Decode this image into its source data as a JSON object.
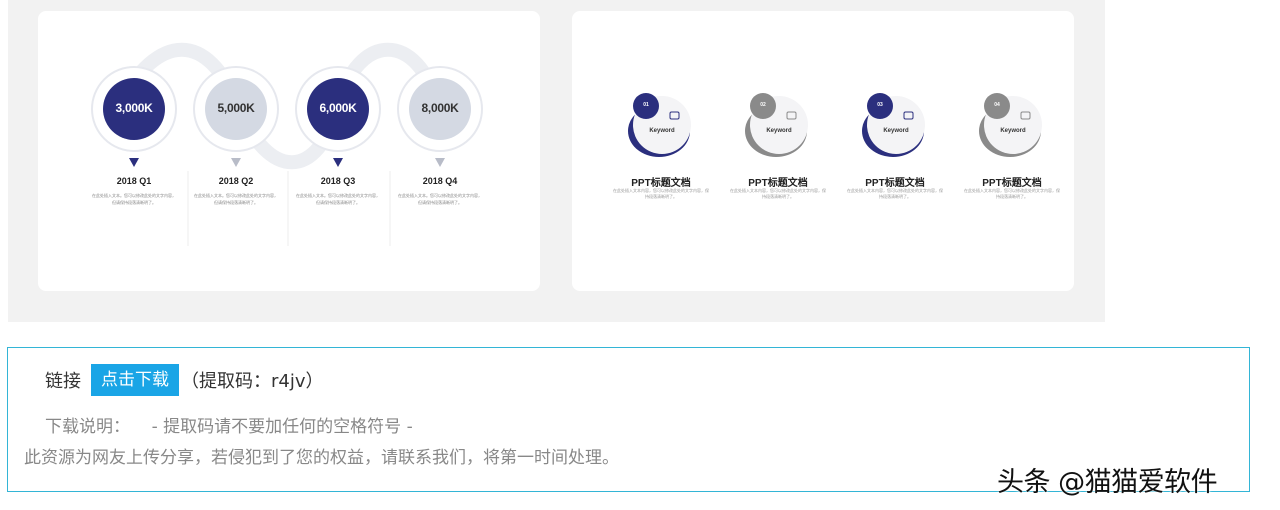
{
  "timeline_slide": {
    "items": [
      {
        "value": "3,000K",
        "quarter": "2018 Q1",
        "desc": "在此处插入文本。您可以修改此处的文字内容，但请保持段落清晰明了。",
        "theme": "dark"
      },
      {
        "value": "5,000K",
        "quarter": "2018 Q2",
        "desc": "在此处插入文本。您可以修改此处的文字内容，但请保持段落清晰明了。",
        "theme": "light"
      },
      {
        "value": "6,000K",
        "quarter": "2018 Q3",
        "desc": "在此处插入文本。您可以修改此处的文字内容，但请保持段落清晰明了。",
        "theme": "dark"
      },
      {
        "value": "8,000K",
        "quarter": "2018 Q4",
        "desc": "在此处插入文本。您可以修改此处的文字内容，但请保持段落清晰明了。",
        "theme": "light"
      }
    ]
  },
  "keyword_slide": {
    "items": [
      {
        "num": "01",
        "keyword": "Keyword",
        "title": "PPT标题文档",
        "desc": "在此处插入文本内容，您可以修改此处的文字内容，保持段落清晰明了。",
        "icon": "camera-icon",
        "theme": "dark"
      },
      {
        "num": "02",
        "keyword": "Keyword",
        "title": "PPT标题文档",
        "desc": "在此处插入文本内容，您可以修改此处的文字内容，保持段落清晰明了。",
        "icon": "clipboard-icon",
        "theme": "gray"
      },
      {
        "num": "03",
        "keyword": "Keyword",
        "title": "PPT标题文档",
        "desc": "在此处插入文本内容，您可以修改此处的文字内容，保持段落清晰明了。",
        "icon": "graduation-cap-icon",
        "theme": "dark"
      },
      {
        "num": "04",
        "keyword": "Keyword",
        "title": "PPT标题文档",
        "desc": "在此处插入文本内容，您可以修改此处的文字内容，保持段落清晰明了。",
        "icon": "monitor-icon",
        "theme": "gray"
      }
    ]
  },
  "download": {
    "link_label": "链接",
    "button_label": "点击下载",
    "code_text": "（提取码：r4jv）",
    "note_label": "下载说明：",
    "note_text": "- 提取码请不要加任何的空格符号 -",
    "disclaimer": "此资源为网友上传分享，若侵犯到了您的权益，请联系我们，将第一时间处理。"
  },
  "watermark": "头条 @猫猫爱软件",
  "colors": {
    "navy": "#2b2f7e",
    "light_circle": "#d4d9e3",
    "gray": "#8a8a8a",
    "accent": "#1aa5e6",
    "border": "#33b5d6"
  }
}
